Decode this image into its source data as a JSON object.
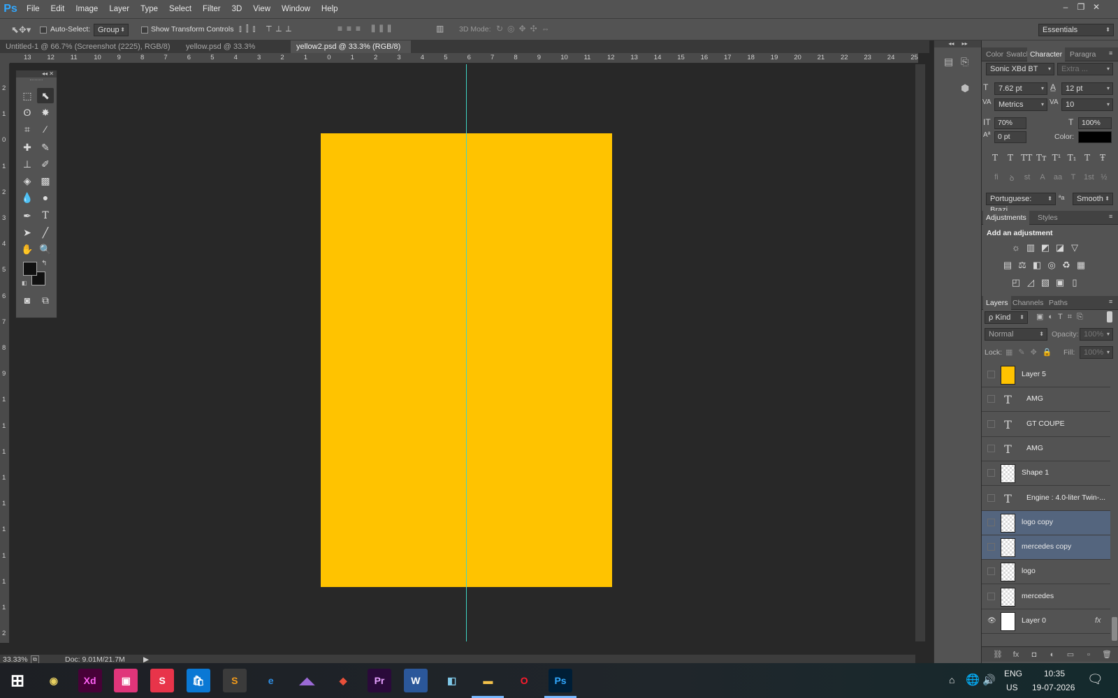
{
  "app": {
    "logo": "Ps"
  },
  "menu": [
    "File",
    "Edit",
    "Image",
    "Layer",
    "Type",
    "Select",
    "Filter",
    "3D",
    "View",
    "Window",
    "Help"
  ],
  "window_controls": [
    "–",
    "❐",
    "✕"
  ],
  "options": {
    "auto_select_label": "Auto-Select:",
    "auto_select_value": "Group",
    "show_transform_label": "Show Transform Controls",
    "mode_3d_label": "3D Mode:",
    "workspace": "Essentials"
  },
  "tabs": [
    {
      "label": "Untitled-1 @ 66.7% (Screenshot (2225), RGB/8) *",
      "active": false
    },
    {
      "label": "yellow.psd @ 33.3% (RGB/8)",
      "active": false
    },
    {
      "label": "yellow2.psd @ 33.3% (RGB/8) *",
      "active": true
    }
  ],
  "ruler_top": [
    "13",
    "12",
    "11",
    "10",
    "9",
    "8",
    "7",
    "6",
    "5",
    "4",
    "3",
    "2",
    "1",
    "0",
    "1",
    "2",
    "3",
    "4",
    "5",
    "6",
    "7",
    "8",
    "9",
    "10",
    "11",
    "12",
    "13",
    "14",
    "15",
    "16",
    "17",
    "18",
    "19",
    "20",
    "21",
    "22",
    "23",
    "24",
    "25",
    "2"
  ],
  "ruler_left": [
    "2",
    "1",
    "0",
    "1",
    "2",
    "3",
    "4",
    "5",
    "6",
    "7",
    "8",
    "9",
    "1",
    "1",
    "1",
    "1",
    "1",
    "1",
    "1",
    "1",
    "1",
    "2"
  ],
  "status": {
    "zoom": "33.33%",
    "doc": "Doc: 9.01M/21.7M"
  },
  "character": {
    "tabs": [
      "Color",
      "Swatche",
      "Character",
      "Paragra"
    ],
    "font_family": "Sonic XBd BT",
    "font_style": "Extra ...",
    "font_size": "7.62 pt",
    "leading": "12 pt",
    "kerning": "Metrics",
    "tracking": "10",
    "vscale": "70%",
    "hscale": "100%",
    "baseline": "0 pt",
    "color_label": "Color:",
    "style_buttons": [
      "T",
      "T",
      "TT",
      "Tт",
      "T¹",
      "T₁",
      "T",
      "Ŧ"
    ],
    "opentype_buttons": [
      "fi",
      "ꝺ",
      "st",
      "A",
      "aa",
      "T",
      "1st",
      "½"
    ],
    "language": "Portuguese: Brazi...",
    "aa_label": "ªa",
    "antialias": "Smooth"
  },
  "adjustments": {
    "tabs": [
      "Adjustments",
      "Styles"
    ],
    "heading": "Add an adjustment",
    "icons_row1": [
      "☼",
      "▥",
      "◩",
      "◪",
      "▽"
    ],
    "icons_row2": [
      "▤",
      "⚖",
      "◧",
      "◎",
      "♻",
      "▦"
    ],
    "icons_row3": [
      "◰",
      "◿",
      "▧",
      "▣",
      "▯"
    ]
  },
  "layers": {
    "tabs": [
      "Layers",
      "Channels",
      "Paths"
    ],
    "filter_kind": "ρ Kind",
    "blend_mode": "Normal",
    "opacity_label": "Opacity:",
    "opacity_value": "100%",
    "lock_label": "Lock:",
    "fill_label": "Fill:",
    "fill_value": "100%",
    "fx_label": "fx",
    "items": [
      {
        "name": "Layer 5",
        "thumb": "yellow",
        "selected": false,
        "visible": false
      },
      {
        "name": "AMG",
        "thumb": "text",
        "selected": false,
        "visible": false
      },
      {
        "name": "GT COUPE",
        "thumb": "text",
        "selected": false,
        "visible": false
      },
      {
        "name": "AMG",
        "thumb": "text",
        "selected": false,
        "visible": false
      },
      {
        "name": "Shape 1",
        "thumb": "checker",
        "selected": false,
        "visible": false
      },
      {
        "name": "Engine :  4.0-liter Twin-...",
        "thumb": "text",
        "selected": false,
        "visible": false
      },
      {
        "name": "logo copy",
        "thumb": "checker",
        "selected": true,
        "visible": false
      },
      {
        "name": "mercedes copy",
        "thumb": "checker",
        "selected": true,
        "visible": false
      },
      {
        "name": "logo",
        "thumb": "checker",
        "selected": false,
        "visible": false
      },
      {
        "name": "mercedes",
        "thumb": "checker",
        "selected": false,
        "visible": false
      },
      {
        "name": "Layer 0",
        "thumb": "white",
        "selected": false,
        "visible": true
      }
    ],
    "footer_icons": [
      "⛓",
      "fx",
      "◘",
      "◐",
      "▭",
      "▫",
      "🗑"
    ]
  },
  "taskbar": {
    "apps": [
      {
        "name": "start",
        "label": "⊞",
        "bg": "transparent",
        "fg": "#ffffff"
      },
      {
        "name": "media",
        "label": "◉",
        "bg": "transparent",
        "fg": "#e8d060"
      },
      {
        "name": "xd",
        "label": "Xd",
        "bg": "#470137",
        "fg": "#ff61f6"
      },
      {
        "name": "app-pink",
        "label": "▣",
        "bg": "#e0357a",
        "fg": "#ffffff"
      },
      {
        "name": "app-s",
        "label": "S",
        "bg": "#e8344a",
        "fg": "#ffffff"
      },
      {
        "name": "store",
        "label": "🛍",
        "bg": "#0a78d4",
        "fg": "#ffffff"
      },
      {
        "name": "sublime",
        "label": "S",
        "bg": "#3b3b3b",
        "fg": "#f59c1a"
      },
      {
        "name": "edge",
        "label": "e",
        "bg": "transparent",
        "fg": "#2f8fe6"
      },
      {
        "name": "visual-studio",
        "label": "◢◣",
        "bg": "transparent",
        "fg": "#9b6ad6"
      },
      {
        "name": "git",
        "label": "◆",
        "bg": "transparent",
        "fg": "#e8503a"
      },
      {
        "name": "premiere",
        "label": "Pr",
        "bg": "#2a0a3a",
        "fg": "#e6a1ff"
      },
      {
        "name": "word",
        "label": "W",
        "bg": "#2b579a",
        "fg": "#ffffff"
      },
      {
        "name": "app-blue",
        "label": "◧",
        "bg": "transparent",
        "fg": "#7fc8e8"
      },
      {
        "name": "explorer",
        "label": "▬",
        "bg": "transparent",
        "fg": "#f3c14a"
      },
      {
        "name": "opera",
        "label": "O",
        "bg": "transparent",
        "fg": "#ff1b2d"
      },
      {
        "name": "photoshop",
        "label": "Ps",
        "bg": "#001e36",
        "fg": "#31a8ff"
      }
    ],
    "tray": {
      "lang": "ENG",
      "region": "US",
      "time": "10:35",
      "date": "19-07-2026"
    }
  },
  "colors": {
    "document": "#ffc300",
    "guide": "#3fd6c8",
    "selected_layer": "#54657e"
  }
}
